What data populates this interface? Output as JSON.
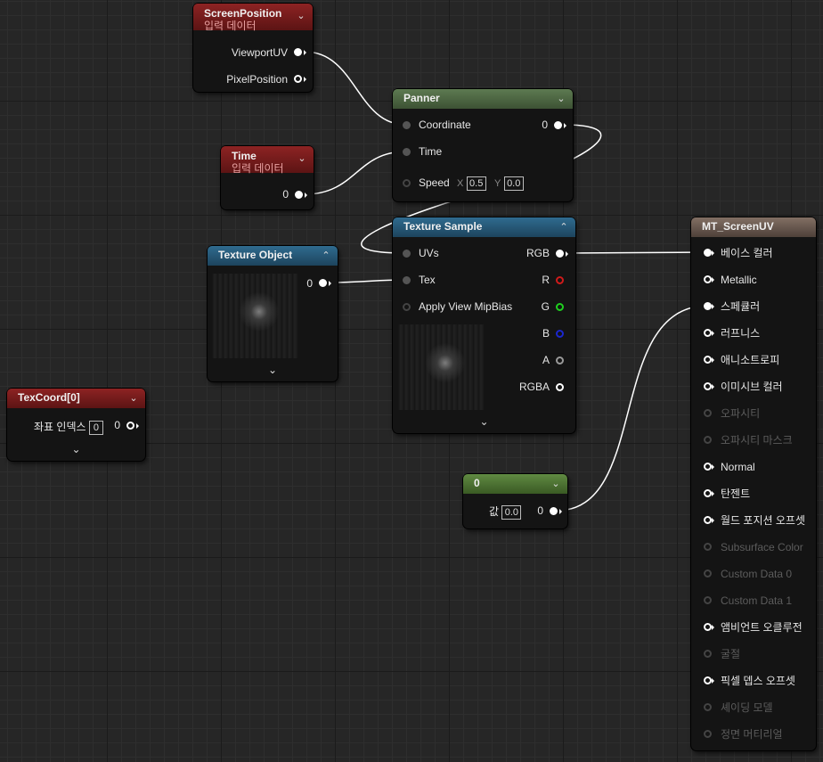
{
  "nodes": {
    "screen_position": {
      "title": "ScreenPosition",
      "subtitle": "입력 데이터",
      "outputs": [
        "ViewportUV",
        "PixelPosition"
      ]
    },
    "time": {
      "title": "Time",
      "subtitle": "입력 데이터",
      "output": "0"
    },
    "panner": {
      "title": "Panner",
      "coordinate": "Coordinate",
      "time": "Time",
      "speed": "Speed",
      "speed_x_label": "X",
      "speed_x": "0.5",
      "speed_y_label": "Y",
      "speed_y": "0.0",
      "output": "0"
    },
    "texture_object": {
      "title": "Texture Object",
      "output": "0"
    },
    "texture_sample": {
      "title": "Texture Sample",
      "inputs": [
        "UVs",
        "Tex",
        "Apply View MipBias"
      ],
      "outputs": [
        "RGB",
        "R",
        "G",
        "B",
        "A",
        "RGBA"
      ]
    },
    "texcoord": {
      "title": "TexCoord[0]",
      "label": "좌표 인덱스",
      "value": "0",
      "output": "0"
    },
    "constant": {
      "title": "0",
      "label": "값",
      "value": "0.0",
      "output": "0"
    },
    "material": {
      "title": "MT_ScreenUV",
      "inputs": [
        "베이스 컬러",
        "Metallic",
        "스페큘러",
        "러프니스",
        "애니소트로피",
        "이미시브 컬러",
        "오파시티",
        "오파시티 마스크",
        "Normal",
        "탄젠트",
        "월드 포지션 오프셋",
        "Subsurface Color",
        "Custom Data 0",
        "Custom Data 1",
        "앰비언트 오클루전",
        "굴절",
        "픽셀 뎁스 오프셋",
        "셰이딩 모델",
        "정면 머티리얼"
      ],
      "enabled": [
        true,
        true,
        true,
        true,
        true,
        true,
        false,
        false,
        true,
        true,
        true,
        false,
        false,
        false,
        true,
        false,
        true,
        false,
        false
      ]
    }
  },
  "colors": {
    "red_header": "#8d2323",
    "green_header": "#5d7a51",
    "blue_header": "#2f6b8f",
    "const_header": "#608a42",
    "result_header": "#826f64",
    "wire": "#ffffff"
  }
}
